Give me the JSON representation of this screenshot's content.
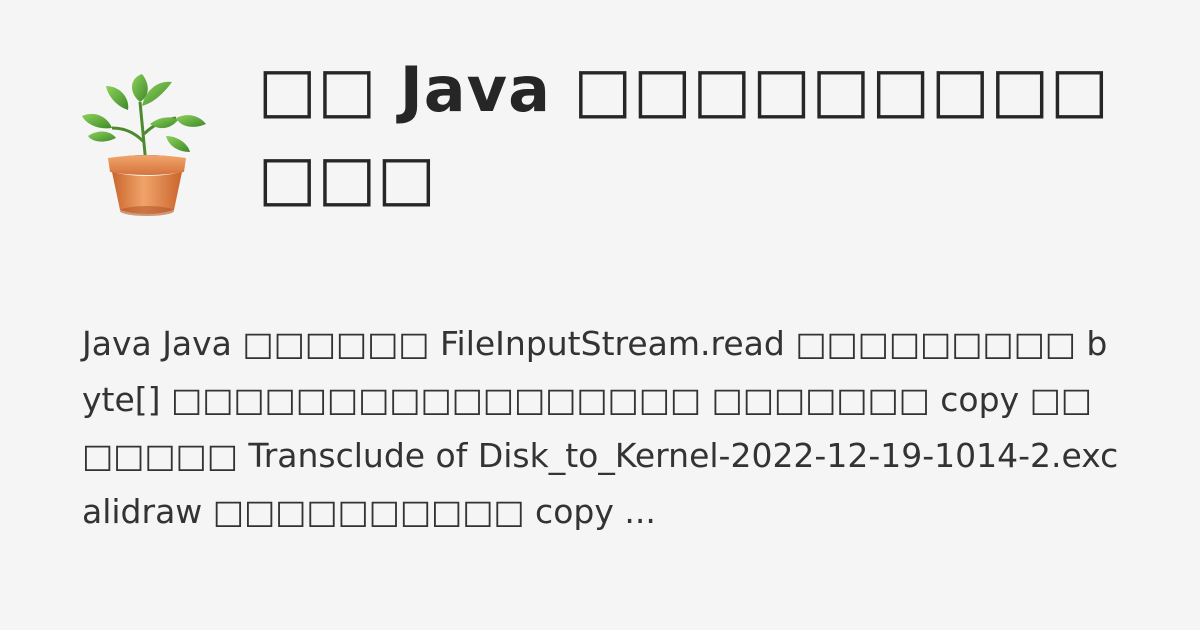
{
  "card": {
    "icon": "potted-plant-icon",
    "title": "□□ Java □□□□□□□□□□□□",
    "description": "Java Java □□□□□□ FileInputStream.read □□□□□□□□□ byte[] □□□□□□□□□□□□□□□□□ □□□□□□□ copy □□□□□□□ Transclude of Disk_to_Kernel-2022-12-19-1014-2.excalidraw □□□□□□□□□□ copy ..."
  },
  "colors": {
    "background": "#f6f5f6",
    "title_text": "#262626",
    "body_text": "#333333",
    "leaf_green": "#5aa83a",
    "pot_orange": "#e0874a"
  }
}
